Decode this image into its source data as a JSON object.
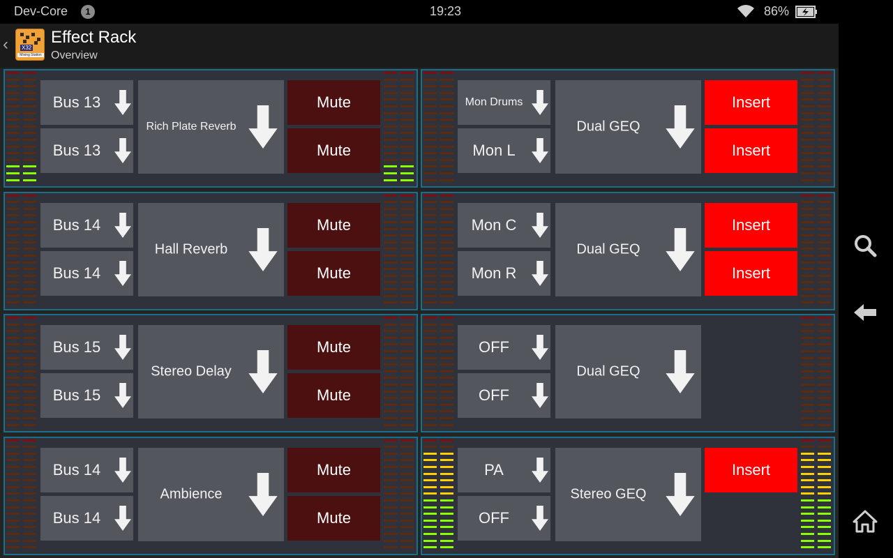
{
  "status": {
    "carrier": "Dev-Core",
    "notifications": "1",
    "time": "19:23",
    "battery": "86%"
  },
  "app": {
    "title": "Effect Rack",
    "subtitle": "Overview",
    "logo_tag": "X32",
    "logo_sub": "Mixing Station"
  },
  "colors": {
    "meter_off": "#5a2b10",
    "meter_green": "#8aff00",
    "meter_yellow": "#ffd000",
    "mute_bg": "#4c1010",
    "insert_bg": "#ff0000",
    "slot_border": "#1a6f8a"
  },
  "slots": [
    {
      "src1": "Bus 13",
      "src2": "Bus 13",
      "fx": "Rich Plate Reverb",
      "btn1": "Mute",
      "btn2": "Mute",
      "btn_type": "mute",
      "meter_in": 3,
      "meter_out": 3
    },
    {
      "src1": "Mon Drums",
      "src2": "Mon L",
      "fx": "Dual GEQ",
      "btn1": "Insert",
      "btn2": "Insert",
      "btn_type": "insert",
      "meter_in": 0,
      "meter_out": 0
    },
    {
      "src1": "Bus 14",
      "src2": "Bus 14",
      "fx": "Hall Reverb",
      "btn1": "Mute",
      "btn2": "Mute",
      "btn_type": "mute",
      "meter_in": 0,
      "meter_out": 0
    },
    {
      "src1": "Mon C",
      "src2": "Mon R",
      "fx": "Dual GEQ",
      "btn1": "Insert",
      "btn2": "Insert",
      "btn_type": "insert",
      "meter_in": 0,
      "meter_out": 0
    },
    {
      "src1": "Bus 15",
      "src2": "Bus 15",
      "fx": "Stereo Delay",
      "btn1": "Mute",
      "btn2": "Mute",
      "btn_type": "mute",
      "meter_in": 0,
      "meter_out": 0
    },
    {
      "src1": "OFF",
      "src2": "OFF",
      "fx": "Dual GEQ",
      "btn1": "",
      "btn2": "",
      "btn_type": "none",
      "meter_in": 0,
      "meter_out": 0
    },
    {
      "src1": "Bus 14",
      "src2": "Bus 14",
      "fx": "Ambience",
      "btn1": "Mute",
      "btn2": "Mute",
      "btn_type": "mute",
      "meter_in": 0,
      "meter_out": 0
    },
    {
      "src1": "PA",
      "src2": "OFF",
      "fx": "Stereo GEQ",
      "btn1": "Insert",
      "btn2": "",
      "btn_type": "insert",
      "meter_in": 15,
      "meter_out": 15
    }
  ],
  "nav": {
    "search": "search-icon",
    "back": "back-icon",
    "home": "home-icon"
  }
}
